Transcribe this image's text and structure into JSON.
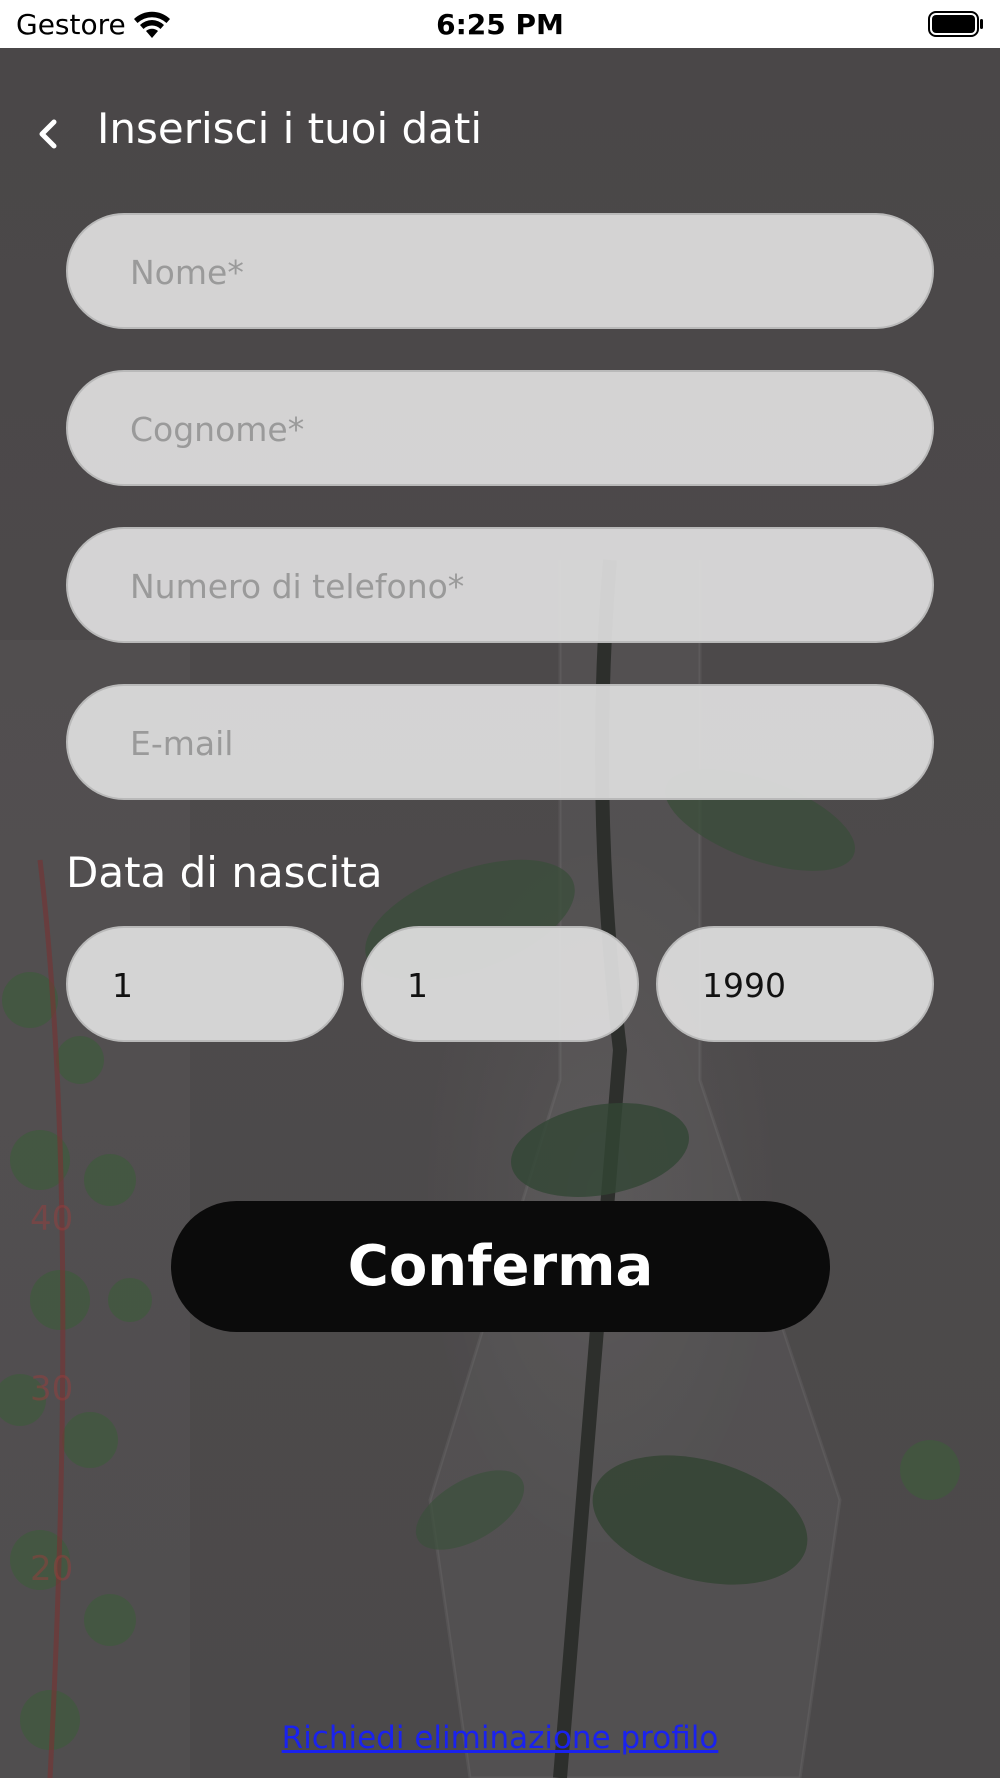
{
  "status_bar": {
    "carrier": "Gestore",
    "time": "6:25 PM"
  },
  "header": {
    "title": "Inserisci i tuoi dati"
  },
  "form": {
    "first_name_placeholder": "Nome*",
    "last_name_placeholder": "Cognome*",
    "phone_placeholder": "Numero di telefono*",
    "email_placeholder": "E-mail",
    "birth_date_label": "Data di nascita",
    "birth_day": "1",
    "birth_month": "1",
    "birth_year": "1990"
  },
  "actions": {
    "confirm_label": "Conferma",
    "delete_profile_link": "Richiedi eliminazione profilo"
  },
  "colors": {
    "background": "#4b4849",
    "field_fill": "#e0e0e0",
    "button": "#0b0b0b",
    "link": "#1a22ee"
  }
}
